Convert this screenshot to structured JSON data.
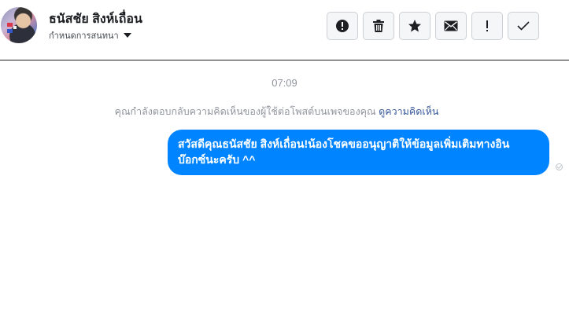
{
  "conversation": {
    "contact_name": "ธนัสชัย สิงห์เถื่อน",
    "assign_label": "กำหนดการสนทนา"
  },
  "toolbar": {
    "buttons": [
      {
        "name": "report-button",
        "icon": "alert-circle-icon"
      },
      {
        "name": "delete-button",
        "icon": "trash-icon"
      },
      {
        "name": "star-button",
        "icon": "star-icon"
      },
      {
        "name": "mark-unread-button",
        "icon": "envelope-icon"
      },
      {
        "name": "mark-important-button",
        "icon": "exclamation-icon"
      },
      {
        "name": "mark-done-button",
        "icon": "check-icon"
      }
    ]
  },
  "thread": {
    "timestamp": "07:09",
    "context_text": "คุณกำลังตอบกลับความคิดเห็นของผู้ใช้ต่อโพสต์บนเพจของคุณ",
    "context_link": "ดูความคิดเห็น",
    "messages": [
      {
        "line1": "สวัสดีคุณธนัสชัย สิงห์เถื่อน!น้องโชคขออนุญาติให้ข้อมูลเพิ่มเติมทางอิน",
        "line2": "บ๊อกซ์นะครับ ^^",
        "status_icon": "sent-check-icon"
      }
    ]
  },
  "colors": {
    "bubble": "#0084ff",
    "link": "#385898",
    "muted": "#90949c",
    "button_bg": "#f5f6f7"
  }
}
